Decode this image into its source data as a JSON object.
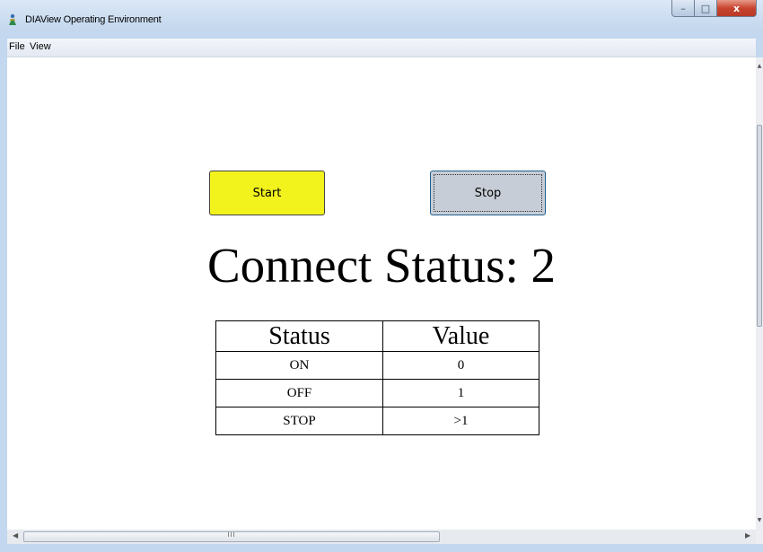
{
  "window": {
    "title": "DIAView Operating Environment",
    "controls": {
      "minimize": "–",
      "maximize": "□",
      "close": "x"
    }
  },
  "menu": {
    "file": "File",
    "view": "View"
  },
  "buttons": {
    "start": "Start",
    "stop": "Stop"
  },
  "connect_status": {
    "text": "Connect Status: 2"
  },
  "status_table": {
    "headers": [
      "Status",
      "Value"
    ],
    "rows": [
      [
        "ON",
        "0"
      ],
      [
        "OFF",
        "1"
      ],
      [
        "STOP",
        ">1"
      ]
    ]
  },
  "scrollbar": {
    "grip": "III"
  },
  "colors": {
    "start_button": "#f2f21d",
    "stop_button": "#c7cdd6",
    "client_bg": "#ffffff"
  }
}
